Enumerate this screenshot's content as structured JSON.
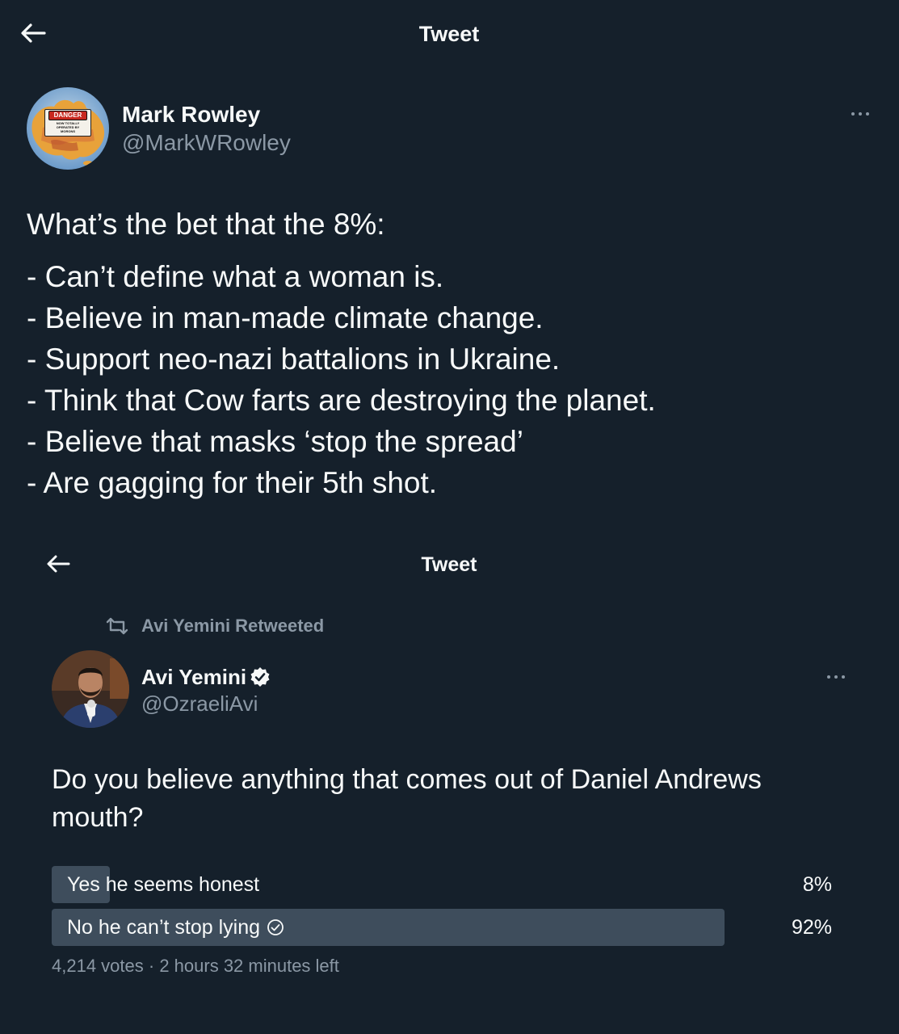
{
  "top_header": {
    "title": "Tweet",
    "back_icon": "back-arrow-icon"
  },
  "main_tweet": {
    "display_name": "Mark Rowley",
    "handle": "@MarkWRowley",
    "avatar": {
      "sign_title": "DANGER",
      "sign_line1": "NOW TOTALLY",
      "sign_line2": "OPERATED BY",
      "sign_line3": "MORONS"
    },
    "more_icon": "more-horizontal-icon",
    "intro": "What’s the bet that the 8%:",
    "lines": [
      "- Can’t define what a woman is.",
      "- Believe in man-made climate change.",
      "- Support neo-nazi battalions in Ukraine.",
      "- Think that Cow farts are destroying the planet.",
      "- Believe that masks ‘stop the spread’",
      "- Are gagging for their 5th shot."
    ]
  },
  "quoted_screenshot": {
    "header_title": "Tweet",
    "retweet_label": "Avi Yemini Retweeted",
    "display_name": "Avi Yemini",
    "verified": true,
    "handle": "@OzraeliAvi",
    "text": "Do you believe anything that comes out of Daniel Andrews mouth?",
    "poll": {
      "options": [
        {
          "label": "Yes he seems honest",
          "percent_text": "8%",
          "percent": 8,
          "selected": false
        },
        {
          "label": "No he can’t stop lying",
          "percent_text": "92%",
          "percent": 92,
          "selected": true
        }
      ],
      "votes": "4,214 votes",
      "separator": "·",
      "time_left": "2 hours 32 minutes left"
    }
  },
  "colors": {
    "background": "#15202b",
    "text": "#f7f9f9",
    "secondary": "#8b98a5",
    "poll_bar": "#3e4d5c"
  }
}
